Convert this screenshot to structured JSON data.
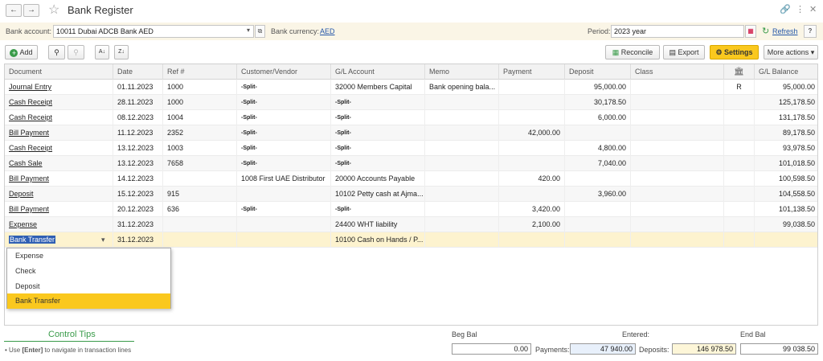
{
  "window": {
    "title": "Bank Register",
    "back_icon": "arrow-left",
    "forward_icon": "arrow-right"
  },
  "params": {
    "bank_account_label": "Bank account:",
    "bank_account_value": "10011 Dubai ADCB Bank AED",
    "bank_currency_label": "Bank currency:",
    "bank_currency_value": "AED",
    "period_label": "Period:",
    "period_value": "2023 year",
    "refresh_label": "Refresh"
  },
  "toolbar": {
    "add": "Add",
    "reconcile": "Reconcile",
    "export": "Export",
    "settings": "Settings",
    "more": "More actions",
    "help": "?"
  },
  "columns": [
    "Document",
    "Date",
    "Ref #",
    "Customer/Vendor",
    "G/L Account",
    "Memo",
    "Payment",
    "Deposit",
    "Class",
    "",
    "G/L Balance"
  ],
  "rows": [
    {
      "doc": "Journal Entry",
      "date": "01.11.2023",
      "ref": "1000",
      "cv": "-Split-",
      "gl": "32000 Members Capital",
      "memo": "Bank opening bala...",
      "payment": "",
      "deposit": "95,000.00",
      "class": "",
      "r": "R",
      "bal": "95,000.00"
    },
    {
      "doc": "Cash Receipt",
      "date": "28.11.2023",
      "ref": "1000",
      "cv": "-Split-",
      "gl": "-Split-",
      "memo": "",
      "payment": "",
      "deposit": "30,178.50",
      "class": "",
      "r": "",
      "bal": "125,178.50"
    },
    {
      "doc": "Cash Receipt",
      "date": "08.12.2023",
      "ref": "1004",
      "cv": "-Split-",
      "gl": "-Split-",
      "memo": "",
      "payment": "",
      "deposit": "6,000.00",
      "class": "",
      "r": "",
      "bal": "131,178.50"
    },
    {
      "doc": "Bill Payment",
      "date": "11.12.2023",
      "ref": "2352",
      "cv": "-Split-",
      "gl": "-Split-",
      "memo": "",
      "payment": "42,000.00",
      "deposit": "",
      "class": "",
      "r": "",
      "bal": "89,178.50"
    },
    {
      "doc": "Cash Receipt",
      "date": "13.12.2023",
      "ref": "1003",
      "cv": "-Split-",
      "gl": "-Split-",
      "memo": "",
      "payment": "",
      "deposit": "4,800.00",
      "class": "",
      "r": "",
      "bal": "93,978.50"
    },
    {
      "doc": "Cash Sale",
      "date": "13.12.2023",
      "ref": "7658",
      "cv": "-Split-",
      "gl": "-Split-",
      "memo": "",
      "payment": "",
      "deposit": "7,040.00",
      "class": "",
      "r": "",
      "bal": "101,018.50"
    },
    {
      "doc": "Bill Payment",
      "date": "14.12.2023",
      "ref": "",
      "cv": "1008 First UAE Distributor",
      "gl": "20000 Accounts Payable",
      "memo": "",
      "payment": "420.00",
      "deposit": "",
      "class": "",
      "r": "",
      "bal": "100,598.50"
    },
    {
      "doc": "Deposit",
      "date": "15.12.2023",
      "ref": "915",
      "cv": "",
      "gl": "10102 Petty cash at Ajma...",
      "memo": "",
      "payment": "",
      "deposit": "3,960.00",
      "class": "",
      "r": "",
      "bal": "104,558.50"
    },
    {
      "doc": "Bill Payment",
      "date": "20.12.2023",
      "ref": "636",
      "cv": "-Split-",
      "gl": "-Split-",
      "memo": "",
      "payment": "3,420.00",
      "deposit": "",
      "class": "",
      "r": "",
      "bal": "101,138.50"
    },
    {
      "doc": "Expense",
      "date": "31.12.2023",
      "ref": "",
      "cv": "",
      "gl": "24400 WHT liability",
      "memo": "",
      "payment": "2,100.00",
      "deposit": "",
      "class": "",
      "r": "",
      "bal": "99,038.50"
    }
  ],
  "edit_row": {
    "doc": "Bank Transfer",
    "date": "31.12.2023",
    "gl": "10100 Cash on Hands / P..."
  },
  "dropdown": [
    "Expense",
    "Check",
    "Deposit",
    "Bank Transfer"
  ],
  "footer": {
    "control_tips": "Control Tips",
    "tip_prefix": "• Use ",
    "tip_key": "[Enter]",
    "tip_suffix": " to navigate in transaction lines",
    "beg_bal_label": "Beg Bal",
    "beg_bal": "0.00",
    "entered_label": "Entered:",
    "payments_label": "Payments:",
    "payments": "47 940.00",
    "deposits_label": "Deposits:",
    "deposits": "146 978.50",
    "end_bal_label": "End Bal",
    "end_bal": "99 038.50"
  },
  "colors": {
    "accent": "#fac81e",
    "link": "#2457a8",
    "tips": "#3a9b4a",
    "highlight": "#fdf3cf"
  }
}
